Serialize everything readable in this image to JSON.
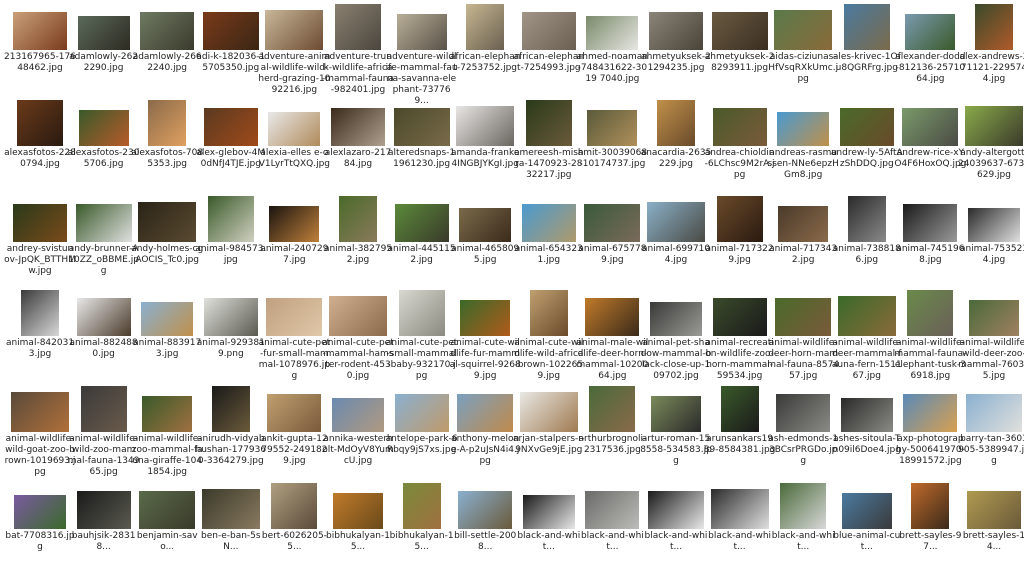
{
  "files": [
    {
      "name": "213167965-17648462.jpg",
      "colors": [
        "#c9a07a",
        "#7a3b1c"
      ],
      "icon": "image-icon"
    },
    {
      "name": "adamlowly-2622290.jpg",
      "colors": [
        "#5a6a5a",
        "#2d2a22"
      ],
      "icon": "image-icon"
    },
    {
      "name": "adamlowly-2662240.jpg",
      "colors": [
        "#6e7a62",
        "#3b3a2c"
      ],
      "icon": "image-icon"
    },
    {
      "name": "adi-k-182036-15705350.jpg",
      "colors": [
        "#7a3a1a",
        "#3a2614"
      ],
      "icon": "image-icon"
    },
    {
      "name": "adventure-animal-wildlife-wild-herd-grazing-1092216.jpg",
      "colors": [
        "#c8b79a",
        "#6d4b32"
      ],
      "icon": "image-icon"
    },
    {
      "name": "adventure-trunk-wildlife-africa-mammal-fauna-982401.jpg",
      "colors": [
        "#8a8070",
        "#4b463e"
      ],
      "icon": "image-icon"
    },
    {
      "name": "adventure-wildlife-mammal-fauna-savanna-elephant-737769...",
      "colors": [
        "#b8ae98",
        "#5a5248"
      ],
      "icon": "image-icon"
    },
    {
      "name": "african-elephant-7253752.jpg",
      "colors": [
        "#c6b690",
        "#6a6050"
      ],
      "icon": "image-icon"
    },
    {
      "name": "african-elephant-7254993.jpg",
      "colors": [
        "#a09586",
        "#6b5f52"
      ],
      "icon": "image-icon"
    },
    {
      "name": "ahmed-noaman-748431622-3019 7040.jpg",
      "colors": [
        "#7a8a6a",
        "#e6e6e2"
      ],
      "icon": "image-icon"
    },
    {
      "name": "ahmetyuksek-21294235.jpg",
      "colors": [
        "#8a8578",
        "#4a4438"
      ],
      "icon": "image-icon"
    },
    {
      "name": "ahmetyuksek-28293911.jpg",
      "colors": [
        "#6a5a40",
        "#3a2e22"
      ],
      "icon": "image-icon"
    },
    {
      "name": "aidas-ciziunas-HfVsqRXkUmc.jpg",
      "colors": [
        "#5a7a4a",
        "#8a6a3a"
      ],
      "icon": "image-icon"
    },
    {
      "name": "ales-krivec-1Ofu8QGRFrg.jpg",
      "colors": [
        "#4a7aa0",
        "#7a6a4a"
      ],
      "icon": "image-icon"
    },
    {
      "name": "alexander-dodd-812136-2571064.jpg",
      "colors": [
        "#7a9ab0",
        "#3a5a2a"
      ],
      "icon": "image-icon"
    },
    {
      "name": "alex-andrews-271121-2295744.jpg",
      "colors": [
        "#3a4a2a",
        "#b05a2a"
      ],
      "icon": "image-icon"
    },
    {
      "name": "alexasfotos-2280794.jpg",
      "colors": [
        "#6a3a1a",
        "#2a1a10"
      ],
      "icon": "image-icon"
    },
    {
      "name": "alexasfotos-2305706.jpg",
      "colors": [
        "#3a5a2a",
        "#b85a2a"
      ],
      "icon": "image-icon"
    },
    {
      "name": "alexasfotos-7085353.jpg",
      "colors": [
        "#8a6a4a",
        "#e0a060"
      ],
      "icon": "image-icon"
    },
    {
      "name": "alex-glebov-4M0dNfJ4TJE.jpg",
      "colors": [
        "#5a3a20",
        "#a04a1a"
      ],
      "icon": "image-icon"
    },
    {
      "name": "alexia-elles e-oV1LyrTtQXQ.jpg",
      "colors": [
        "#e8e8e8",
        "#b08a5a"
      ],
      "icon": "image-icon"
    },
    {
      "name": "alexlazaro-21784.jpg",
      "colors": [
        "#3a2a1a",
        "#b0a090"
      ],
      "icon": "image-icon"
    },
    {
      "name": "alteredsnaps-11961230.jpg",
      "colors": [
        "#4a4a2a",
        "#7a6a4a"
      ],
      "icon": "image-icon"
    },
    {
      "name": "amanda-franke4INGBJYKgI.jpg",
      "colors": [
        "#e8e6e4",
        "#6a6660"
      ],
      "icon": "image-icon"
    },
    {
      "name": "amereesh-mishra-1470923-2832217.jpg",
      "colors": [
        "#2a3a1a",
        "#6a5a3a"
      ],
      "icon": "image-icon"
    },
    {
      "name": "amit-30039068-10174737.jpg",
      "colors": [
        "#5a5a3a",
        "#b0905a"
      ],
      "icon": "image-icon"
    },
    {
      "name": "anacardia-2635229.jpg",
      "colors": [
        "#c0904a",
        "#6a4a2a"
      ],
      "icon": "image-icon"
    },
    {
      "name": "andrea-chioldin-6LChsc9M2rA.jpg",
      "colors": [
        "#4a5a2a",
        "#7a5a3a"
      ],
      "icon": "image-icon"
    },
    {
      "name": "andreas-rasmussen-NNe6epzHGm8.jpg",
      "colors": [
        "#4a9ad0",
        "#c0904a"
      ],
      "icon": "image-icon"
    },
    {
      "name": "andrew-ly-5AftAzShDDQ.jpg",
      "colors": [
        "#4a6a2a",
        "#6a4a2a"
      ],
      "icon": "image-icon"
    },
    {
      "name": "andrew-rice-xYO4F6HoxOQ.jpg",
      "colors": [
        "#7a9a6a",
        "#4a4a44"
      ],
      "icon": "image-icon"
    },
    {
      "name": "andy-altergott-24039637-6739629.jpg",
      "colors": [
        "#8aaa4a",
        "#3a3a2a"
      ],
      "icon": "image-icon"
    },
    {
      "name": "andrey-svistunov-JpQK_BTTHMw.jpg",
      "colors": [
        "#2a3a1a",
        "#7a4a1a"
      ],
      "icon": "image-icon"
    },
    {
      "name": "andy-brunner-A10ZZ_oBBME.jpg",
      "colors": [
        "#3a5a2a",
        "#e0e0e0"
      ],
      "icon": "image-icon"
    },
    {
      "name": "andy-holmes-cgAOCIS_Tc0.jpg",
      "colors": [
        "#2a2418",
        "#5a4a30"
      ],
      "icon": "image-icon"
    },
    {
      "name": "animal-984573.jpg",
      "colors": [
        "#3a5a2a",
        "#d0d0c0"
      ],
      "icon": "image-icon"
    },
    {
      "name": "animal-2407297.jpg",
      "colors": [
        "#1a1410",
        "#c0803a"
      ],
      "icon": "image-icon"
    },
    {
      "name": "animal-3827952.jpg",
      "colors": [
        "#4a6a2a",
        "#8a7a5a"
      ],
      "icon": "image-icon"
    },
    {
      "name": "animal-4451152.jpg",
      "colors": [
        "#5a8a3a",
        "#3a3a2a"
      ],
      "icon": "image-icon"
    },
    {
      "name": "animal-4658095.jpg",
      "colors": [
        "#7a6a4a",
        "#3a2a1a"
      ],
      "icon": "image-icon"
    },
    {
      "name": "animal-6543231.jpg",
      "colors": [
        "#4a9ad0",
        "#b09a6a"
      ],
      "icon": "image-icon"
    },
    {
      "name": "animal-6757789.jpg",
      "colors": [
        "#3a5a3a",
        "#7a6a5a"
      ],
      "icon": "image-icon"
    },
    {
      "name": "animal-6997104.jpg",
      "colors": [
        "#8ab0c8",
        "#4a4a44"
      ],
      "icon": "image-icon"
    },
    {
      "name": "animal-7173229.jpg",
      "colors": [
        "#6a4a2a",
        "#2a1a10"
      ],
      "icon": "image-icon"
    },
    {
      "name": "animal-7173432.jpg",
      "colors": [
        "#4a3a2a",
        "#8a6a4a"
      ],
      "icon": "image-icon"
    },
    {
      "name": "animal-7388186.jpg",
      "colors": [
        "#2a2a2a",
        "#8a8a8a"
      ],
      "icon": "image-icon"
    },
    {
      "name": "animal-7451968.jpg",
      "colors": [
        "#1a1a1a",
        "#9a9a9a"
      ],
      "icon": "image-icon"
    },
    {
      "name": "animal-7535234.jpg",
      "colors": [
        "#2a2a2a",
        "#e0e0e0"
      ],
      "icon": "image-icon"
    },
    {
      "name": "animal-8420313.jpg",
      "colors": [
        "#3a3a3a",
        "#d8d8d8"
      ],
      "icon": "image-icon"
    },
    {
      "name": "animal-8824880.jpg",
      "colors": [
        "#e8e8e8",
        "#4a3a2a"
      ],
      "icon": "image-icon"
    },
    {
      "name": "animal-8839173.jpg",
      "colors": [
        "#8ab0d0",
        "#c0904a"
      ],
      "icon": "image-icon"
    },
    {
      "name": "animal-9293819.png",
      "colors": [
        "#e0e0dc",
        "#5a5a50"
      ],
      "icon": "image-icon"
    },
    {
      "name": "animal-cute-pet-fur-small-mammal-1078976.jpg",
      "colors": [
        "#c0a080",
        "#e0c8a8"
      ],
      "icon": "image-icon"
    },
    {
      "name": "animal-cute-pet-mammal-hamster-rodent-4530.jpg",
      "colors": [
        "#d0b090",
        "#8a6a4a"
      ],
      "icon": "image-icon"
    },
    {
      "name": "animal-cute-pet-small-mammal-baby-932170.jpg",
      "colors": [
        "#d8d8d0",
        "#8a8a80"
      ],
      "icon": "image-icon"
    },
    {
      "name": "animal-cute-wildlife-fur-mammal-squirrel-92689.jpg",
      "colors": [
        "#3a6a2a",
        "#b05a1a"
      ],
      "icon": "image-icon"
    },
    {
      "name": "animal-cute-wildlife-wild-africa-brown-1022659.jpg",
      "colors": [
        "#c0a070",
        "#6a4a2a"
      ],
      "icon": "image-icon"
    },
    {
      "name": "animal-male-wildlife-deer-horn-mammal-1020064.jpg",
      "colors": [
        "#c07a2a",
        "#3a2a1a"
      ],
      "icon": "image-icon"
    },
    {
      "name": "animal-pet-shadow-mammal-black-close-up-109702.jpg",
      "colors": [
        "#3a3a38",
        "#9a9a96"
      ],
      "icon": "image-icon"
    },
    {
      "name": "animal-recreation-wildlife-zoo-horn-mammal-59534.jpg",
      "colors": [
        "#3a4a2a",
        "#1a1a1a"
      ],
      "icon": "image-icon"
    },
    {
      "name": "animal-wildlife-deer-horn-mammal-fauna-857457.jpg",
      "colors": [
        "#4a6a2a",
        "#7a5a3a"
      ],
      "icon": "image-icon"
    },
    {
      "name": "animal-wildlife-deer-mammal-fauna-fern-151167.jpg",
      "colors": [
        "#3a6a2a",
        "#8a6a3a"
      ],
      "icon": "image-icon"
    },
    {
      "name": "animal-wildlife-mammal-fauna-elephant-tusk-36918.jpg",
      "colors": [
        "#6a8a4a",
        "#6a6058"
      ],
      "icon": "image-icon"
    },
    {
      "name": "animal-wildlife-wild-deer-zoo-mammal-760395.jpg",
      "colors": [
        "#4a6a3a",
        "#a08060"
      ],
      "icon": "image-icon"
    },
    {
      "name": "animal-wildlife-wild-goat-zoo-brown-1019693.jpg",
      "colors": [
        "#5a4a3a",
        "#b0703a"
      ],
      "icon": "image-icon"
    },
    {
      "name": "animal-wildlife-wild-zoo-mammal-fauna-134965.jpg",
      "colors": [
        "#3a3a3a",
        "#6a5a4a"
      ],
      "icon": "image-icon"
    },
    {
      "name": "animal-wildlife-zoo-mammal-fauna-giraffe-1041854.jpg",
      "colors": [
        "#3a5a2a",
        "#a07040"
      ],
      "icon": "image-icon"
    },
    {
      "name": "anirudh-vidyabhushan-1779360-3364279.jpg",
      "colors": [
        "#1a1a1a",
        "#6a5a3a"
      ],
      "icon": "image-icon"
    },
    {
      "name": "ankit-gupta-1279552-2491829.jpg",
      "colors": [
        "#c0a070",
        "#7a5a3a"
      ],
      "icon": "image-icon"
    },
    {
      "name": "annika-westerholt-MdOyV8YumcU.jpg",
      "colors": [
        "#6a8ab0",
        "#b09a80"
      ],
      "icon": "image-icon"
    },
    {
      "name": "antelope-park-6Rbqy9jS7xs.jpg",
      "colors": [
        "#8ab0d0",
        "#c09a6a"
      ],
      "icon": "image-icon"
    },
    {
      "name": "anthony-melone-A-p2uJsN4i4.jpg",
      "colors": [
        "#7aa0c0",
        "#c08a4a"
      ],
      "icon": "image-icon"
    },
    {
      "name": "arjan-stalpers-r-9NXvGe9jE.jpg",
      "colors": [
        "#e8e8e4",
        "#a07a50"
      ],
      "icon": "image-icon"
    },
    {
      "name": "arthurbrognoli-2317536.jpg",
      "colors": [
        "#4a6a3a",
        "#8a6a4a"
      ],
      "icon": "image-icon"
    },
    {
      "name": "artur-roman-158558-534583.jpg",
      "colors": [
        "#7a8a5a",
        "#2a2a2a"
      ],
      "icon": "image-icon"
    },
    {
      "name": "arunsankars1989-8584381.jpg",
      "colors": [
        "#3a5a2a",
        "#1a1a1a"
      ],
      "icon": "image-icon"
    },
    {
      "name": "ash-edmonds-13BCsrPRGDo.jpg",
      "colors": [
        "#3a3a38",
        "#8a8a86"
      ],
      "icon": "image-icon"
    },
    {
      "name": "ashes-sitoula-Tn09il6Doe4.jpg",
      "colors": [
        "#2a2a28",
        "#8a8a86"
      ],
      "icon": "image-icon"
    },
    {
      "name": "axp-photography-500641970-18991572.jpg",
      "colors": [
        "#5a8ab8",
        "#d8a050"
      ],
      "icon": "image-icon"
    },
    {
      "name": "barry-tan-3603905-5389947.jpg",
      "colors": [
        "#8ab0d0",
        "#e0e0dc"
      ],
      "icon": "image-icon"
    },
    {
      "name": "bat-7708316.jpg",
      "colors": [
        "#7a5aa0",
        "#3a6a2a"
      ],
      "icon": "image-icon"
    },
    {
      "name": "bauhjsik-28318...",
      "colors": [
        "#1a1a1a",
        "#5a5a50"
      ],
      "icon": "image-icon"
    },
    {
      "name": "benjamin-savo...",
      "colors": [
        "#5a6a4a",
        "#3a3a2a"
      ],
      "icon": "image-icon"
    },
    {
      "name": "ben-e-ban-5sN...",
      "colors": [
        "#3a3a2a",
        "#8a7a60"
      ],
      "icon": "image-icon"
    },
    {
      "name": "bert-6026205-5...",
      "colors": [
        "#b0a080",
        "#5a4a3a"
      ],
      "icon": "image-icon"
    },
    {
      "name": "bibhukalyan-15...",
      "colors": [
        "#c07a2a",
        "#6a4a1a"
      ],
      "icon": "image-icon"
    },
    {
      "name": "bibhukalyan-15...",
      "colors": [
        "#7a8a3a",
        "#a07040"
      ],
      "icon": "image-icon"
    },
    {
      "name": "bill-settle-2008...",
      "colors": [
        "#8ab0d0",
        "#6a5a3a"
      ],
      "icon": "image-icon"
    },
    {
      "name": "black-and-whit...",
      "colors": [
        "#1a1a1a",
        "#e8e8e8"
      ],
      "icon": "image-icon"
    },
    {
      "name": "black-and-whit...",
      "colors": [
        "#6a6a68",
        "#bcbcb8"
      ],
      "icon": "image-icon"
    },
    {
      "name": "black-and-whit...",
      "colors": [
        "#1a1a1a",
        "#e8e8e8"
      ],
      "icon": "image-icon"
    },
    {
      "name": "black-and-whit...",
      "colors": [
        "#2a2a2a",
        "#e0e0e0"
      ],
      "icon": "image-icon"
    },
    {
      "name": "black-and-whit...",
      "colors": [
        "#4a6a3a",
        "#d8d8d8"
      ],
      "icon": "image-icon"
    },
    {
      "name": "blue-animal-cut...",
      "colors": [
        "#4a7aa0",
        "#3a3a3a"
      ],
      "icon": "image-icon"
    },
    {
      "name": "brett-sayles-97...",
      "colors": [
        "#c06a2a",
        "#3a2a1a"
      ],
      "icon": "image-icon"
    },
    {
      "name": "brett-sayles-14...",
      "colors": [
        "#b09a50",
        "#6a5a3a"
      ],
      "icon": "image-icon"
    }
  ]
}
